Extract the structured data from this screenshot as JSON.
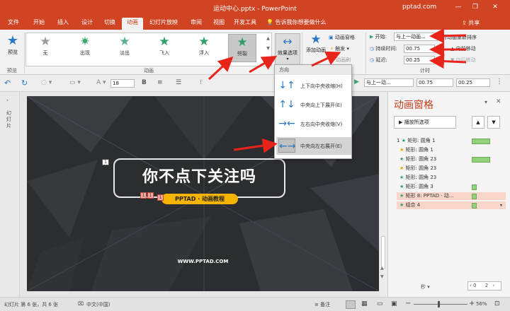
{
  "titlebar": {
    "title": "运动中心.pptx - PowerPoint",
    "site": "pptad.com",
    "min": "—",
    "restore": "❐",
    "close": "✕"
  },
  "tabs": [
    "文件",
    "开始",
    "插入",
    "设计",
    "切换",
    "动画",
    "幻灯片放映",
    "审阅",
    "视图",
    "开发工具"
  ],
  "tell_me": "告诉我你想要做什么",
  "share": "共享",
  "ribbon": {
    "preview": "预览",
    "preview_group": "预览",
    "animations": [
      {
        "label": "无"
      },
      {
        "label": "出现"
      },
      {
        "label": "淡出"
      },
      {
        "label": "飞入"
      },
      {
        "label": "浮入"
      },
      {
        "label": "劈裂"
      }
    ],
    "anim_group": "动画",
    "effect_options": "效果选项",
    "add_animation": "添加动画",
    "anim_pane_btn": "动画窗格",
    "trigger": "触发",
    "painter": "动画刷",
    "start_label": "开始:",
    "start_value": "与上一动画...",
    "duration_label": "持续时间:",
    "duration_value": "00.75",
    "delay_label": "延迟:",
    "delay_value": "00.25",
    "reorder": "对动画重新排序",
    "move_earlier": "向前移动",
    "move_later": "向后移动",
    "timing_group": "计时"
  },
  "fmtrow": {
    "font_size": "18",
    "start_value": "与上一动...",
    "duration": "00.75",
    "delay": "00.25"
  },
  "thumb_label": "幻灯片",
  "slide": {
    "headline": "你不点下关注吗",
    "badge": "PPTAD · 动画教程",
    "url": "WWW.PPTAD.COM",
    "tag_one": "1",
    "tags": [
      "1",
      "1",
      "1"
    ]
  },
  "dropdown": {
    "header": "方向",
    "items": [
      {
        "label": "上下向中央收缩(H)",
        "icon": "↓↑"
      },
      {
        "label": "中央向上下展开(E)",
        "icon": "↑↓"
      },
      {
        "label": "左右向中央收缩(V)",
        "icon": "→←"
      },
      {
        "label": "中央向左右展开(E)",
        "icon": "←→"
      }
    ]
  },
  "pane": {
    "title": "动画窗格",
    "play_btn": "播放所选项",
    "items": [
      {
        "num": "1",
        "label": "矩形: 圆角 1"
      },
      {
        "num": "",
        "label": "矩形: 圆角 1"
      },
      {
        "num": "",
        "label": "矩形: 圆角 23"
      },
      {
        "num": "",
        "label": "矩形: 圆角 23"
      },
      {
        "num": "",
        "label": "矩形: 圆角 23"
      },
      {
        "num": "",
        "label": "矩形: 圆角 3"
      },
      {
        "num": "",
        "label": "矩形 8: PPTAD · 动..."
      },
      {
        "num": "",
        "label": "组合 4"
      }
    ],
    "seconds": "秒",
    "timeline_start": "0",
    "timeline_end": "2"
  },
  "status": {
    "slide_info": "幻灯片 第 6 张，共 6 张",
    "language": "中文(中国)",
    "notes": "备注",
    "zoom": "56%",
    "minus": "−",
    "plus": "+"
  },
  "colors": {
    "accent": "#d04424",
    "arrow": "#e8241a",
    "badge": "#f5b400",
    "bar": "#92d27a"
  }
}
